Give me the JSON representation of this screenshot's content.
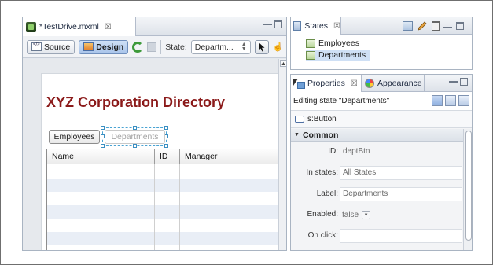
{
  "editor": {
    "tab_title": "*TestDrive.mxml",
    "tab_close": "☒",
    "toolbar": {
      "source_label": "Source",
      "design_label": "Design",
      "state_label": "State:",
      "state_value": "Departm..."
    },
    "app": {
      "title": "XYZ Corporation Directory",
      "employees_button": "Employees",
      "departments_button": "Departments",
      "grid_columns": [
        "Name",
        "ID",
        "Manager"
      ],
      "grid_rows": 6
    }
  },
  "states_panel": {
    "tab_title": "States",
    "tab_close": "☒",
    "items": [
      {
        "label": "Employees",
        "selected": false
      },
      {
        "label": "Departments",
        "selected": true
      }
    ]
  },
  "properties_panel": {
    "tab_title": "Properties",
    "tab_close": "☒",
    "tab2_title": "Appearance",
    "editing_state": "Editing state \"Departments\"",
    "component": "s:Button",
    "section": "Common",
    "fields": [
      {
        "label": "ID:",
        "value": "deptBtn"
      },
      {
        "label": "In states:",
        "value": "All States"
      },
      {
        "label": "Label:",
        "value": "Departments"
      },
      {
        "label": "Enabled:",
        "value": "false"
      },
      {
        "label": "On click:",
        "value": ""
      }
    ]
  },
  "colors": {
    "app_title": "#8b1a1a",
    "selection_highlight": "#cfe0f5",
    "handle_border": "#3b8fc2"
  }
}
